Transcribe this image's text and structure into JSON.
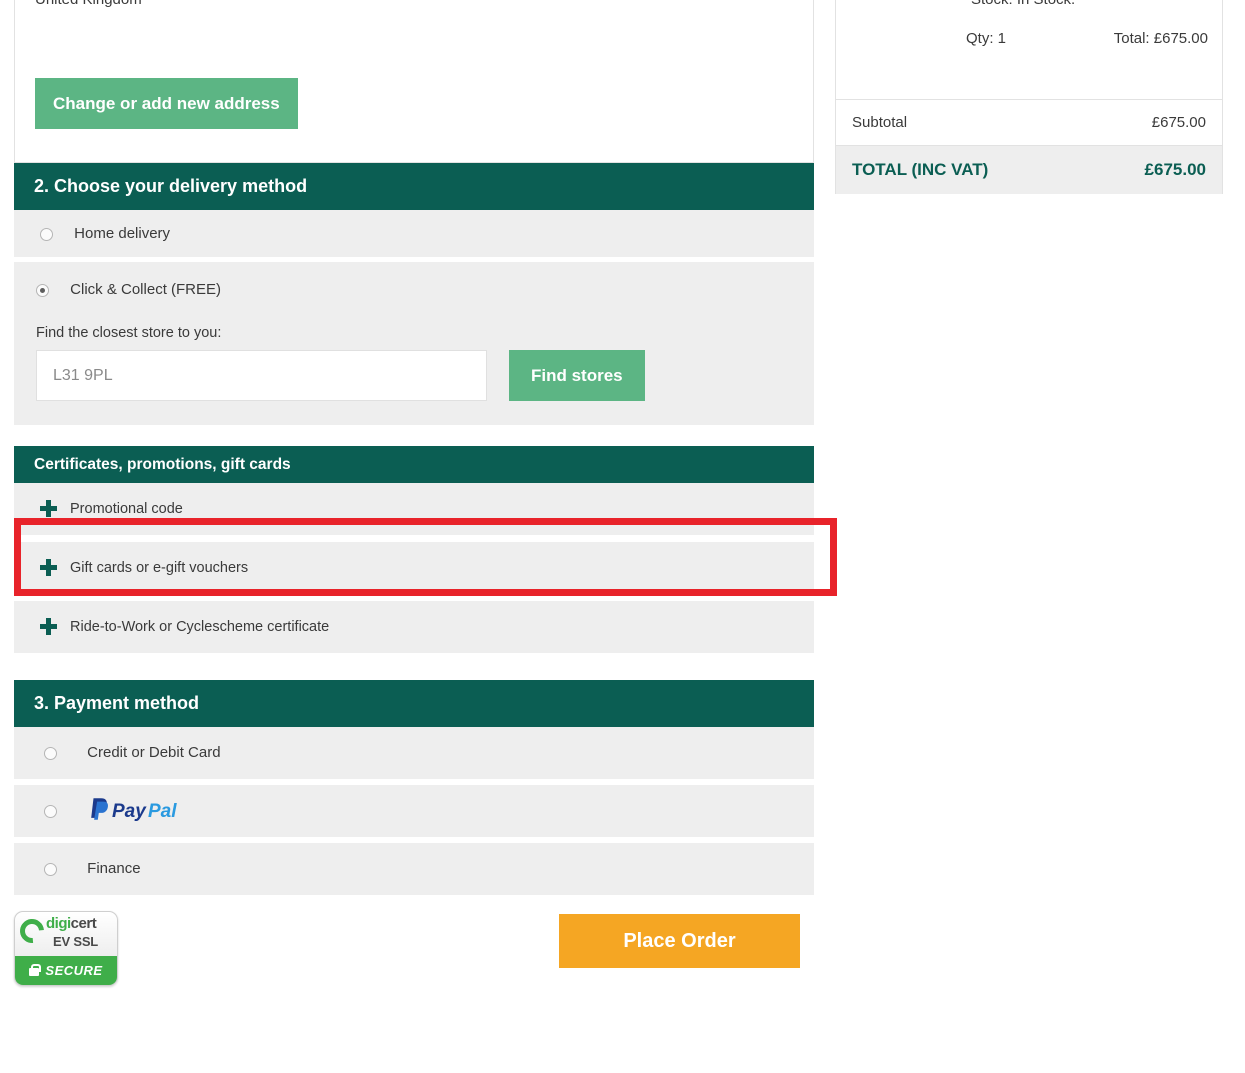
{
  "address": {
    "country_line": "United Kingdom",
    "change_button": "Change or add new address"
  },
  "delivery": {
    "header": "2. Choose your delivery method",
    "options": [
      {
        "label": "Home delivery",
        "selected": false
      },
      {
        "label": "Click & Collect (FREE)",
        "selected": true
      }
    ],
    "find_store_label": "Find the closest store to you:",
    "postcode_value": "L31 9PL",
    "postcode_placeholder": "L31 9PL",
    "find_stores_button": "Find stores"
  },
  "certificates": {
    "header": "Certificates, promotions, gift cards",
    "rows": [
      {
        "label": "Promotional code",
        "icon": "plus-icon",
        "highlighted": true
      },
      {
        "label": "Gift cards or e-gift vouchers",
        "icon": "plus-icon",
        "highlighted": false
      },
      {
        "label": "Ride-to-Work or Cyclescheme certificate",
        "icon": "plus-icon",
        "highlighted": false
      }
    ]
  },
  "payment": {
    "header": "3. Payment method",
    "options": [
      {
        "label": "Credit or Debit Card",
        "selected": false,
        "type": "text"
      },
      {
        "label": "PayPal",
        "selected": false,
        "type": "logo"
      },
      {
        "label": "Finance",
        "selected": false,
        "type": "text"
      }
    ]
  },
  "footer": {
    "seal": {
      "word_a": "digi",
      "word_b": "cert",
      "line2": "EV SSL",
      "banner": "SECURE"
    },
    "place_order_button": "Place Order"
  },
  "summary": {
    "stock_line": "Stock:  In Stock.",
    "qty_line": "Qty: 1",
    "item_total_line": "Total: £675.00",
    "subtotal_label": "Subtotal",
    "subtotal_value": "£675.00",
    "total_label": "TOTAL (INC VAT)",
    "total_value": "£675.00"
  },
  "colors": {
    "teal": "#0b5e53",
    "green": "#5cb584",
    "amber": "#f5a623",
    "highlight_red": "#e8232a",
    "row_grey": "#eeeeee"
  }
}
